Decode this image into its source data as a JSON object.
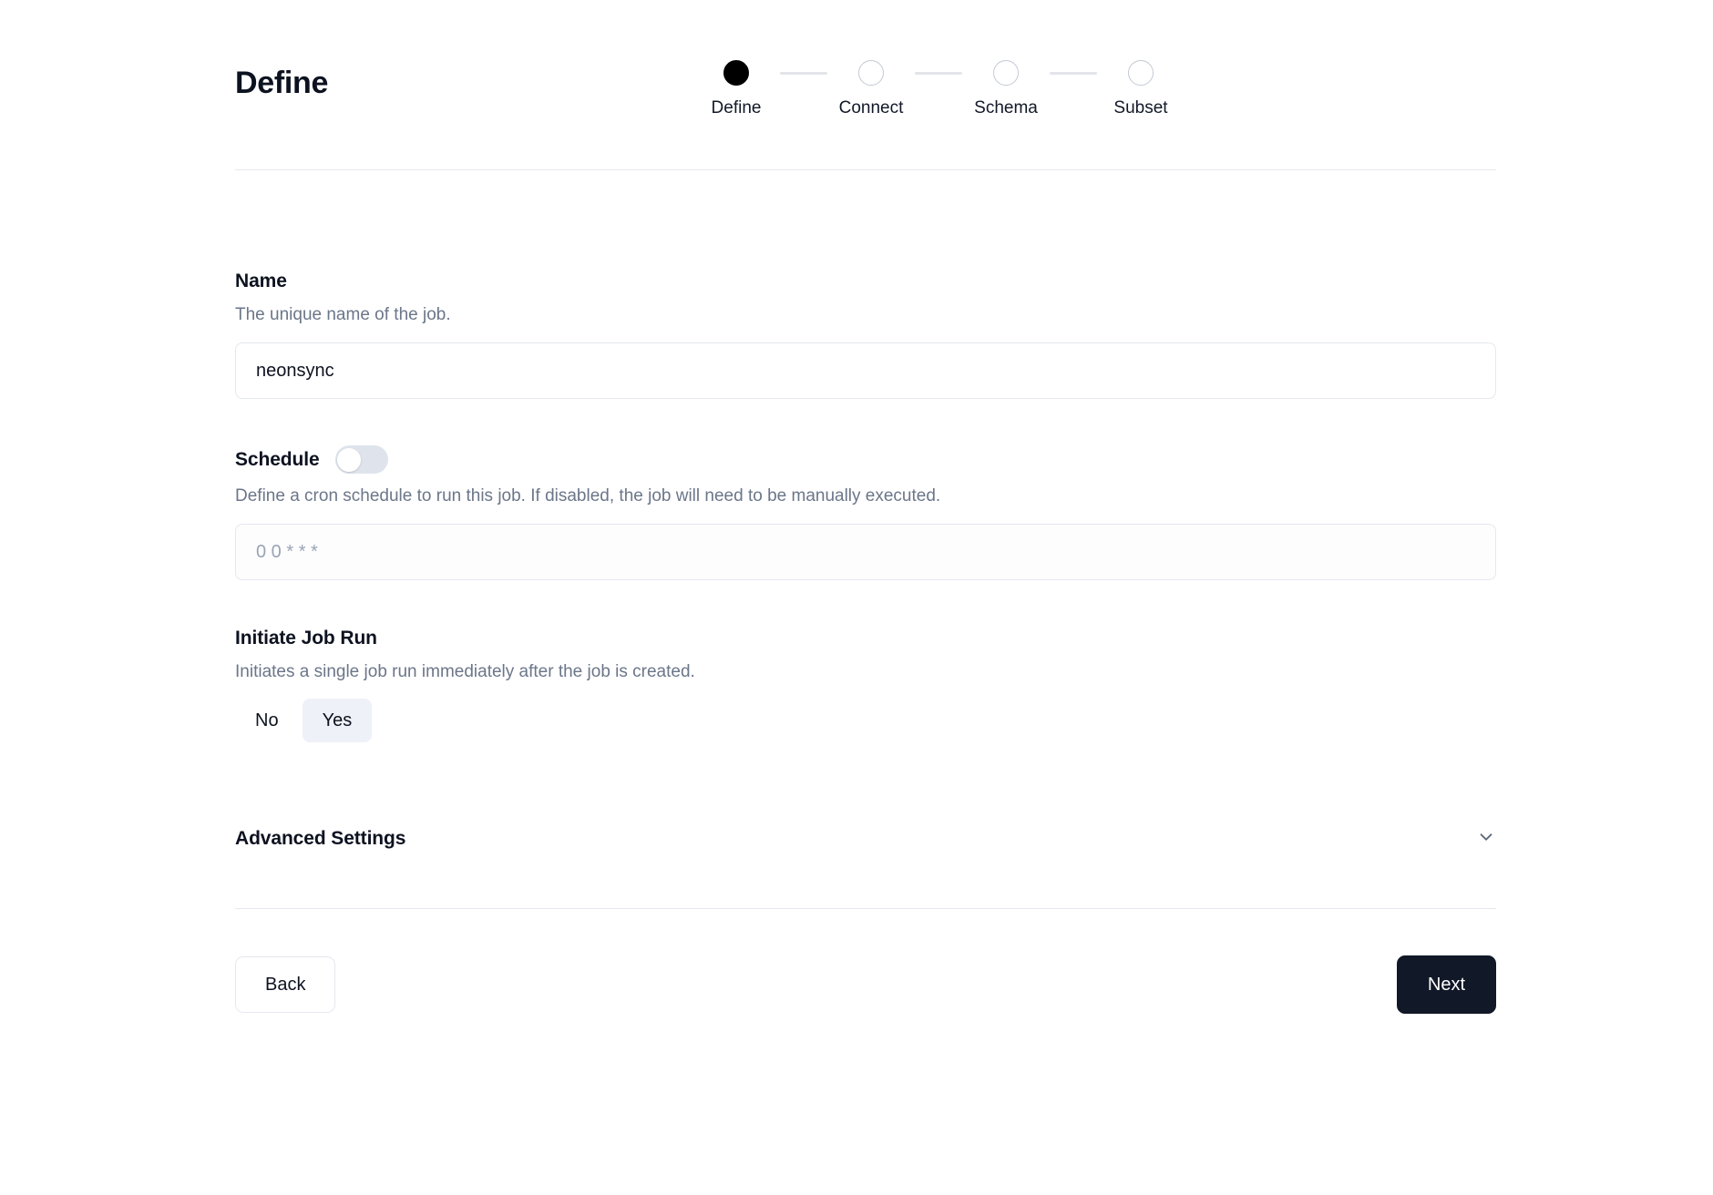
{
  "header": {
    "title": "Define",
    "steps": [
      {
        "label": "Define",
        "state": "active"
      },
      {
        "label": "Connect",
        "state": "inactive"
      },
      {
        "label": "Schema",
        "state": "inactive"
      },
      {
        "label": "Subset",
        "state": "inactive"
      }
    ]
  },
  "form": {
    "name": {
      "label": "Name",
      "description": "The unique name of the job.",
      "value": "neonsync",
      "placeholder": ""
    },
    "schedule": {
      "label": "Schedule",
      "description": "Define a cron schedule to run this job. If disabled, the job will need to be manually executed.",
      "toggle_state": "off",
      "cron_value": "",
      "cron_placeholder": "0 0 * * *"
    },
    "initiate_job_run": {
      "label": "Initiate Job Run",
      "description": "Initiates a single job run immediately after the job is created.",
      "options": [
        {
          "label": "No",
          "selected": false
        },
        {
          "label": "Yes",
          "selected": true
        }
      ]
    },
    "advanced_settings": {
      "label": "Advanced Settings",
      "icon": "chevron-down-icon",
      "expanded": false
    }
  },
  "footer": {
    "back_label": "Back",
    "next_label": "Next"
  },
  "colors": {
    "accent": "#111827",
    "step_active": "#000000",
    "border": "#e5e8ed",
    "muted_text": "#6b7689",
    "selected_chip": "#eef1f7",
    "toggle_track": "#dfe4ec"
  }
}
